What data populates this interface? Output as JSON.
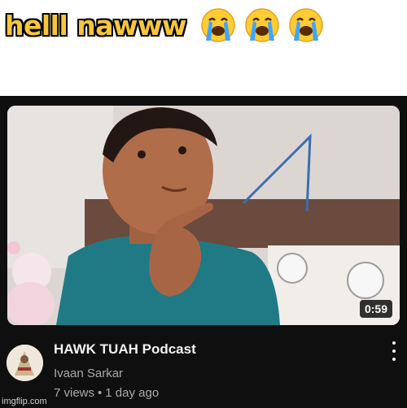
{
  "caption": {
    "text": "helll nawww",
    "emojis": [
      "loudly-crying-face-icon",
      "loudly-crying-face-icon",
      "loudly-crying-face-icon"
    ]
  },
  "video": {
    "duration": "0:59",
    "title": "HAWK TUAH Podcast",
    "channel": "Ivaan Sarkar",
    "views": "7 views",
    "separator": "•",
    "age": "1 day ago",
    "more_icon": "more-vertical-icon"
  },
  "watermark": "imgflip.com",
  "colors": {
    "caption_text": "#f6c63c",
    "card_background": "#0f0f0f",
    "title_text": "#f1f1f1",
    "secondary_text": "#aaaaaa"
  }
}
